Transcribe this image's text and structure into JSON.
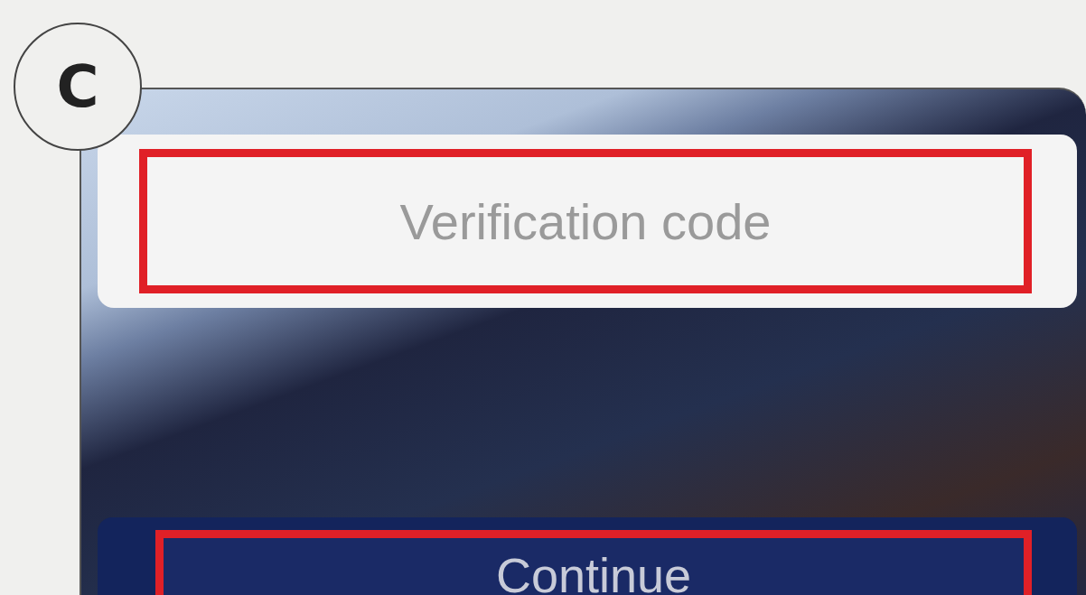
{
  "step_badge": "C",
  "verification_field": {
    "placeholder": "Verification code",
    "highlighted": true
  },
  "continue_button": {
    "label": "Continue",
    "highlighted": true
  }
}
